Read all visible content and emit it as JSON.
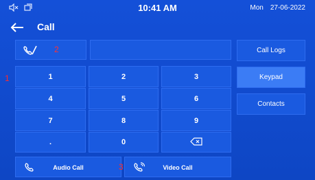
{
  "statusbar": {
    "time": "10:41 AM",
    "day": "Mon",
    "date": "27-06-2022",
    "icons": [
      "speaker-muted-icon",
      "screen-icon"
    ]
  },
  "header": {
    "title": "Call",
    "back_icon": "arrow-left-icon"
  },
  "line_selector": {
    "icon": "phone-slash-icon",
    "marker": "2"
  },
  "number_display": {
    "value": ""
  },
  "side_menu": [
    {
      "label": "Call Logs",
      "active": false
    },
    {
      "label": "Keypad",
      "active": true
    },
    {
      "label": "Contacts",
      "active": false
    }
  ],
  "keypad": {
    "marker": "1",
    "keys": [
      "1",
      "2",
      "3",
      "4",
      "5",
      "6",
      "7",
      "8",
      "9",
      ".",
      "0",
      "backspace-icon"
    ]
  },
  "call_actions": {
    "audio_label": "Audio Call",
    "video_label": "Video Call",
    "marker": "3"
  },
  "colors": {
    "background": "#0f48c8",
    "tile": "#1a5ae0",
    "active_tile": "#3b7cf5",
    "marker": "#ff2a2a"
  }
}
